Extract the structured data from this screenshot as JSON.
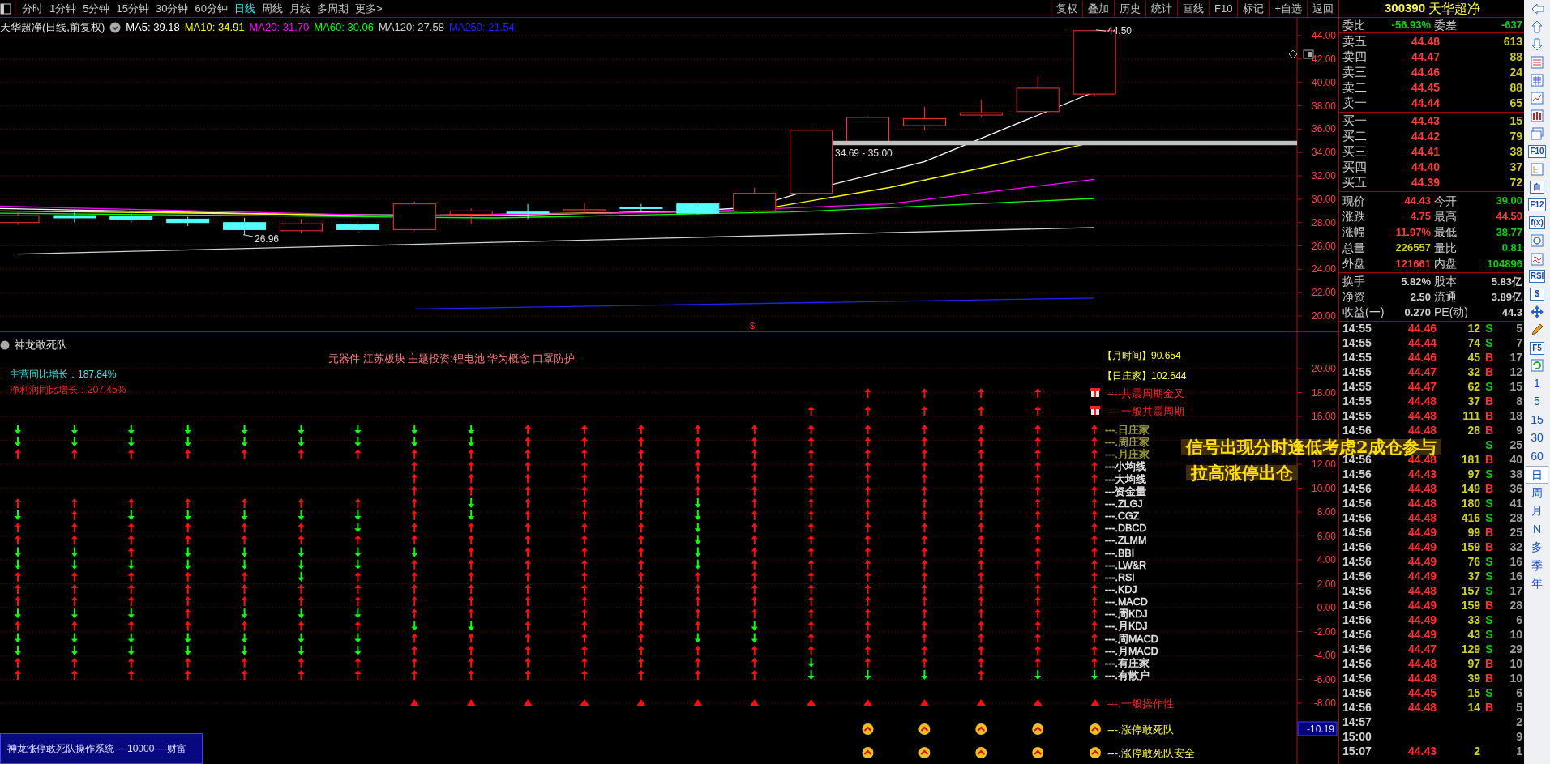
{
  "toolbar": {
    "tabs": [
      {
        "label": "分时",
        "selected": false
      },
      {
        "label": "1分钟",
        "selected": false
      },
      {
        "label": "5分钟",
        "selected": false
      },
      {
        "label": "15分钟",
        "selected": false
      },
      {
        "label": "30分钟",
        "selected": false
      },
      {
        "label": "60分钟",
        "selected": false
      },
      {
        "label": "日线",
        "selected": true
      },
      {
        "label": "周线",
        "selected": false
      },
      {
        "label": "月线",
        "selected": false
      },
      {
        "label": "多周期",
        "selected": false
      },
      {
        "label": "更多>",
        "selected": false
      }
    ],
    "buttons": [
      "复权",
      "叠加",
      "历史",
      "统计",
      "画线",
      "F10",
      "标记",
      "+自选",
      "返回"
    ]
  },
  "chart": {
    "title": "天华超净(日线,前复权)",
    "ma": [
      {
        "label": "MA5: 39.18",
        "color": "#ffffff"
      },
      {
        "label": "MA10: 34.91",
        "color": "#ffff00"
      },
      {
        "label": "MA20: 31.70",
        "color": "#ff00ff"
      },
      {
        "label": "MA60: 30.06",
        "color": "#00ff00"
      },
      {
        "label": "MA120: 27.58",
        "color": "#d0d0d0"
      },
      {
        "label": "MA250: 21.54",
        "color": "#2020ff"
      }
    ],
    "price_ticks": [
      "44.00",
      "42.00",
      "40.00",
      "38.00",
      "36.00",
      "34.00",
      "32.00",
      "30.00",
      "28.00",
      "26.00",
      "24.00",
      "22.00",
      "20.00"
    ],
    "high_label": "44.50",
    "low_label": "26.96",
    "band_label": "34.69 - 35.00",
    "marker": "$"
  },
  "indicator": {
    "title": "神龙敢死队",
    "concepts": "元器件 江苏板块 主题投资:锂电池 华为概念 口罩防护",
    "growth": [
      {
        "text": "主营同比增长：187.84%",
        "color": "#40e0e0"
      },
      {
        "text": "净利润同比增长：207.45%",
        "color": "#ff2020"
      }
    ],
    "axis_ticks": [
      "20.00",
      "18.00",
      "16.00",
      "12.00",
      "10.00",
      "8.00",
      "6.00",
      "4.00",
      "2.00",
      "0.00",
      "-2.00",
      "-4.00",
      "-6.00",
      "-8.00"
    ],
    "current_value": "-10.19",
    "system_label": "神龙涨停敢死队操作系统----10000----财富",
    "notes": [
      "【月时间】90.654",
      "【日庄家】102.644"
    ],
    "events": [
      {
        "label": "----共震周期金叉",
        "kind": "gift"
      },
      {
        "label": "----一般共震周期",
        "kind": "gift"
      }
    ],
    "signal_rows": [
      {
        "label": "---.日庄家",
        "color": "#a0a040"
      },
      {
        "label": "---.周庄家",
        "color": "#a0a040"
      },
      {
        "label": "---.月庄家",
        "color": "#a0a040"
      },
      {
        "label": "---小均线",
        "color": "#e8e8e8"
      },
      {
        "label": "---大均线",
        "color": "#e8e8e8"
      },
      {
        "label": "---资金量",
        "color": "#e8e8e8"
      },
      {
        "label": "---.ZLGJ",
        "color": "#e8e8e8"
      },
      {
        "label": "---.CGZ",
        "color": "#e8e8e8"
      },
      {
        "label": "---.DBCD",
        "color": "#e8e8e8"
      },
      {
        "label": "---.ZLMM",
        "color": "#e8e8e8"
      },
      {
        "label": "---.BBI",
        "color": "#e8e8e8"
      },
      {
        "label": "---.LW&R",
        "color": "#e8e8e8"
      },
      {
        "label": "---.RSI",
        "color": "#e8e8e8"
      },
      {
        "label": "---.KDJ",
        "color": "#e8e8e8"
      },
      {
        "label": "---.MACD",
        "color": "#e8e8e8"
      },
      {
        "label": "---.周KDJ",
        "color": "#e8e8e8"
      },
      {
        "label": "---.月KDJ",
        "color": "#e8e8e8"
      },
      {
        "label": "---.周MACD",
        "color": "#e8e8e8"
      },
      {
        "label": "---.月MACD",
        "color": "#e8e8e8"
      },
      {
        "label": "---.有庄家",
        "color": "#e8e8e8"
      },
      {
        "label": "---.有散户",
        "color": "#e8e8e8"
      }
    ],
    "markers": [
      {
        "label": "---.一般操作性",
        "kind": "triangle"
      },
      {
        "label": "---.涨停敢死队",
        "kind": "coin"
      },
      {
        "label": "---.涨停敢死队安全",
        "kind": "coin"
      }
    ],
    "columns": [
      {
        "signals": [
          {
            "kind": "down"
          },
          {
            "kind": "down"
          },
          {
            "kind": "up"
          },
          {
            "kind": "blank"
          },
          {
            "kind": "blank"
          },
          {
            "kind": "blank"
          },
          {
            "kind": "up"
          },
          {
            "kind": "down"
          },
          {
            "kind": "up"
          },
          {
            "kind": "up"
          },
          {
            "kind": "down"
          },
          {
            "kind": "down"
          },
          {
            "kind": "up"
          },
          {
            "kind": "up"
          },
          {
            "kind": "up"
          },
          {
            "kind": "down"
          },
          {
            "kind": "up"
          },
          {
            "kind": "down"
          },
          {
            "kind": "down"
          },
          {
            "kind": "up"
          },
          {
            "kind": "up"
          }
        ]
      },
      {
        "signals": [
          {
            "kind": "down"
          },
          {
            "kind": "down"
          },
          {
            "kind": "up"
          },
          {
            "kind": "blank"
          },
          {
            "kind": "blank"
          },
          {
            "kind": "blank"
          },
          {
            "kind": "up"
          },
          {
            "kind": "up"
          },
          {
            "kind": "up"
          },
          {
            "kind": "up"
          },
          {
            "kind": "down"
          },
          {
            "kind": "down"
          },
          {
            "kind": "up"
          },
          {
            "kind": "up"
          },
          {
            "kind": "up"
          },
          {
            "kind": "down"
          },
          {
            "kind": "up"
          },
          {
            "kind": "down"
          },
          {
            "kind": "down"
          },
          {
            "kind": "up"
          },
          {
            "kind": "up"
          }
        ]
      },
      {
        "signals": [
          {
            "kind": "down"
          },
          {
            "kind": "down"
          },
          {
            "kind": "up"
          },
          {
            "kind": "blank"
          },
          {
            "kind": "blank"
          },
          {
            "kind": "blank"
          },
          {
            "kind": "up"
          },
          {
            "kind": "down"
          },
          {
            "kind": "up"
          },
          {
            "kind": "up"
          },
          {
            "kind": "up"
          },
          {
            "kind": "down"
          },
          {
            "kind": "up"
          },
          {
            "kind": "up"
          },
          {
            "kind": "up"
          },
          {
            "kind": "down"
          },
          {
            "kind": "up"
          },
          {
            "kind": "down"
          },
          {
            "kind": "down"
          },
          {
            "kind": "up"
          },
          {
            "kind": "up"
          }
        ]
      },
      {
        "signals": [
          {
            "kind": "down"
          },
          {
            "kind": "down"
          },
          {
            "kind": "up"
          },
          {
            "kind": "blank"
          },
          {
            "kind": "blank"
          },
          {
            "kind": "blank"
          },
          {
            "kind": "up"
          },
          {
            "kind": "down"
          },
          {
            "kind": "up"
          },
          {
            "kind": "up"
          },
          {
            "kind": "down"
          },
          {
            "kind": "down"
          },
          {
            "kind": "up"
          },
          {
            "kind": "up"
          },
          {
            "kind": "up"
          },
          {
            "kind": "up"
          },
          {
            "kind": "up"
          },
          {
            "kind": "down"
          },
          {
            "kind": "down"
          },
          {
            "kind": "up"
          },
          {
            "kind": "up"
          }
        ]
      },
      {
        "signals": [
          {
            "kind": "down"
          },
          {
            "kind": "down"
          },
          {
            "kind": "up"
          },
          {
            "kind": "blank"
          },
          {
            "kind": "blank"
          },
          {
            "kind": "blank"
          },
          {
            "kind": "up"
          },
          {
            "kind": "down"
          },
          {
            "kind": "up"
          },
          {
            "kind": "up"
          },
          {
            "kind": "down"
          },
          {
            "kind": "down"
          },
          {
            "kind": "up"
          },
          {
            "kind": "up"
          },
          {
            "kind": "up"
          },
          {
            "kind": "down"
          },
          {
            "kind": "up"
          },
          {
            "kind": "down"
          },
          {
            "kind": "down"
          },
          {
            "kind": "up"
          },
          {
            "kind": "up"
          }
        ]
      },
      {
        "signals": [
          {
            "kind": "down"
          },
          {
            "kind": "down"
          },
          {
            "kind": "up"
          },
          {
            "kind": "blank"
          },
          {
            "kind": "blank"
          },
          {
            "kind": "blank"
          },
          {
            "kind": "up"
          },
          {
            "kind": "down"
          },
          {
            "kind": "up"
          },
          {
            "kind": "up"
          },
          {
            "kind": "down"
          },
          {
            "kind": "down"
          },
          {
            "kind": "down"
          },
          {
            "kind": "up"
          },
          {
            "kind": "up"
          },
          {
            "kind": "down"
          },
          {
            "kind": "up"
          },
          {
            "kind": "down"
          },
          {
            "kind": "down"
          },
          {
            "kind": "up"
          },
          {
            "kind": "up"
          }
        ]
      },
      {
        "signals": [
          {
            "kind": "down"
          },
          {
            "kind": "down"
          },
          {
            "kind": "up"
          },
          {
            "kind": "blank"
          },
          {
            "kind": "blank"
          },
          {
            "kind": "blank"
          },
          {
            "kind": "up"
          },
          {
            "kind": "down"
          },
          {
            "kind": "down"
          },
          {
            "kind": "up"
          },
          {
            "kind": "down"
          },
          {
            "kind": "down"
          },
          {
            "kind": "up"
          },
          {
            "kind": "up"
          },
          {
            "kind": "up"
          },
          {
            "kind": "down"
          },
          {
            "kind": "up"
          },
          {
            "kind": "down"
          },
          {
            "kind": "down"
          },
          {
            "kind": "up"
          },
          {
            "kind": "up"
          }
        ]
      },
      {
        "signals": [
          {
            "kind": "down"
          },
          {
            "kind": "down"
          },
          {
            "kind": "up"
          },
          {
            "kind": "up"
          },
          {
            "kind": "up"
          },
          {
            "kind": "up"
          },
          {
            "kind": "up"
          },
          {
            "kind": "up"
          },
          {
            "kind": "up"
          },
          {
            "kind": "up"
          },
          {
            "kind": "down"
          },
          {
            "kind": "up"
          },
          {
            "kind": "up"
          },
          {
            "kind": "up"
          },
          {
            "kind": "up"
          },
          {
            "kind": "up"
          },
          {
            "kind": "down"
          },
          {
            "kind": "up"
          },
          {
            "kind": "up"
          },
          {
            "kind": "up"
          },
          {
            "kind": "up"
          }
        ],
        "operable": true
      },
      {
        "signals": [
          {
            "kind": "down"
          },
          {
            "kind": "down"
          },
          {
            "kind": "up"
          },
          {
            "kind": "up"
          },
          {
            "kind": "up"
          },
          {
            "kind": "up"
          },
          {
            "kind": "down"
          },
          {
            "kind": "down"
          },
          {
            "kind": "up"
          },
          {
            "kind": "up"
          },
          {
            "kind": "up"
          },
          {
            "kind": "up"
          },
          {
            "kind": "up"
          },
          {
            "kind": "up"
          },
          {
            "kind": "up"
          },
          {
            "kind": "up"
          },
          {
            "kind": "down"
          },
          {
            "kind": "up"
          },
          {
            "kind": "up"
          },
          {
            "kind": "up"
          },
          {
            "kind": "up"
          }
        ],
        "operable": true
      },
      {
        "signals": [
          {
            "kind": "up"
          },
          {
            "kind": "up"
          },
          {
            "kind": "up"
          },
          {
            "kind": "up"
          },
          {
            "kind": "up"
          },
          {
            "kind": "up"
          },
          {
            "kind": "up"
          },
          {
            "kind": "up"
          },
          {
            "kind": "up"
          },
          {
            "kind": "up"
          },
          {
            "kind": "up"
          },
          {
            "kind": "up"
          },
          {
            "kind": "up"
          },
          {
            "kind": "up"
          },
          {
            "kind": "up"
          },
          {
            "kind": "up"
          },
          {
            "kind": "up"
          },
          {
            "kind": "up"
          },
          {
            "kind": "up"
          },
          {
            "kind": "up"
          },
          {
            "kind": "up"
          }
        ],
        "operable": true
      },
      {
        "signals": [
          {
            "kind": "up"
          },
          {
            "kind": "up"
          },
          {
            "kind": "up"
          },
          {
            "kind": "up"
          },
          {
            "kind": "up"
          },
          {
            "kind": "up"
          },
          {
            "kind": "up"
          },
          {
            "kind": "up"
          },
          {
            "kind": "up"
          },
          {
            "kind": "up"
          },
          {
            "kind": "up"
          },
          {
            "kind": "up"
          },
          {
            "kind": "up"
          },
          {
            "kind": "up"
          },
          {
            "kind": "up"
          },
          {
            "kind": "up"
          },
          {
            "kind": "up"
          },
          {
            "kind": "up"
          },
          {
            "kind": "up"
          },
          {
            "kind": "up"
          },
          {
            "kind": "up"
          }
        ],
        "operable": true
      },
      {
        "signals": [
          {
            "kind": "up"
          },
          {
            "kind": "up"
          },
          {
            "kind": "up"
          },
          {
            "kind": "up"
          },
          {
            "kind": "up"
          },
          {
            "kind": "up"
          },
          {
            "kind": "up"
          },
          {
            "kind": "up"
          },
          {
            "kind": "up"
          },
          {
            "kind": "up"
          },
          {
            "kind": "up"
          },
          {
            "kind": "up"
          },
          {
            "kind": "up"
          },
          {
            "kind": "up"
          },
          {
            "kind": "up"
          },
          {
            "kind": "up"
          },
          {
            "kind": "up"
          },
          {
            "kind": "up"
          },
          {
            "kind": "up"
          },
          {
            "kind": "up"
          },
          {
            "kind": "up"
          }
        ],
        "operable": true
      },
      {
        "signals": [
          {
            "kind": "up"
          },
          {
            "kind": "up"
          },
          {
            "kind": "up"
          },
          {
            "kind": "up"
          },
          {
            "kind": "up"
          },
          {
            "kind": "up"
          },
          {
            "kind": "down"
          },
          {
            "kind": "down"
          },
          {
            "kind": "down"
          },
          {
            "kind": "down"
          },
          {
            "kind": "down"
          },
          {
            "kind": "down"
          },
          {
            "kind": "up"
          },
          {
            "kind": "up"
          },
          {
            "kind": "up"
          },
          {
            "kind": "up"
          },
          {
            "kind": "up"
          },
          {
            "kind": "down"
          },
          {
            "kind": "up"
          },
          {
            "kind": "up"
          },
          {
            "kind": "up"
          }
        ],
        "operable": true
      },
      {
        "signals": [
          {
            "kind": "up"
          },
          {
            "kind": "up"
          },
          {
            "kind": "up"
          },
          {
            "kind": "up"
          },
          {
            "kind": "up"
          },
          {
            "kind": "up"
          },
          {
            "kind": "up"
          },
          {
            "kind": "up"
          },
          {
            "kind": "up"
          },
          {
            "kind": "up"
          },
          {
            "kind": "up"
          },
          {
            "kind": "up"
          },
          {
            "kind": "up"
          },
          {
            "kind": "up"
          },
          {
            "kind": "up"
          },
          {
            "kind": "up"
          },
          {
            "kind": "down"
          },
          {
            "kind": "down"
          },
          {
            "kind": "up"
          },
          {
            "kind": "up"
          },
          {
            "kind": "up"
          }
        ],
        "operable": true
      },
      {
        "signals": [
          {
            "kind": "up"
          },
          {
            "kind": "up"
          },
          {
            "kind": "up"
          },
          {
            "kind": "up"
          },
          {
            "kind": "up"
          },
          {
            "kind": "up"
          },
          {
            "kind": "up"
          },
          {
            "kind": "up"
          },
          {
            "kind": "up"
          },
          {
            "kind": "up"
          },
          {
            "kind": "up"
          },
          {
            "kind": "up"
          },
          {
            "kind": "up"
          },
          {
            "kind": "up"
          },
          {
            "kind": "up"
          },
          {
            "kind": "up"
          },
          {
            "kind": "up"
          },
          {
            "kind": "up"
          },
          {
            "kind": "up"
          },
          {
            "kind": "down"
          },
          {
            "kind": "down"
          }
        ],
        "resonance": true,
        "operable": true
      },
      {
        "signals": [
          {
            "kind": "up"
          },
          {
            "kind": "up"
          },
          {
            "kind": "up"
          },
          {
            "kind": "up"
          },
          {
            "kind": "up"
          },
          {
            "kind": "up"
          },
          {
            "kind": "up"
          },
          {
            "kind": "up"
          },
          {
            "kind": "up"
          },
          {
            "kind": "up"
          },
          {
            "kind": "up"
          },
          {
            "kind": "up"
          },
          {
            "kind": "up"
          },
          {
            "kind": "up"
          },
          {
            "kind": "up"
          },
          {
            "kind": "up"
          },
          {
            "kind": "up"
          },
          {
            "kind": "up"
          },
          {
            "kind": "up"
          },
          {
            "kind": "up"
          },
          {
            "kind": "down"
          }
        ],
        "resonance_cross": true,
        "resonance": true,
        "operable": true,
        "limit_up": true,
        "limit_up_safe": true
      },
      {
        "signals": [
          {
            "kind": "up"
          },
          {
            "kind": "up"
          },
          {
            "kind": "up"
          },
          {
            "kind": "up"
          },
          {
            "kind": "up"
          },
          {
            "kind": "up"
          },
          {
            "kind": "up"
          },
          {
            "kind": "up"
          },
          {
            "kind": "up"
          },
          {
            "kind": "up"
          },
          {
            "kind": "up"
          },
          {
            "kind": "up"
          },
          {
            "kind": "up"
          },
          {
            "kind": "up"
          },
          {
            "kind": "up"
          },
          {
            "kind": "up"
          },
          {
            "kind": "up"
          },
          {
            "kind": "up"
          },
          {
            "kind": "up"
          },
          {
            "kind": "up"
          },
          {
            "kind": "down"
          }
        ],
        "resonance_cross": true,
        "resonance": true,
        "operable": true,
        "limit_up": true,
        "limit_up_safe": true
      },
      {
        "signals": [
          {
            "kind": "up"
          },
          {
            "kind": "up"
          },
          {
            "kind": "up"
          },
          {
            "kind": "up"
          },
          {
            "kind": "up"
          },
          {
            "kind": "up"
          },
          {
            "kind": "up"
          },
          {
            "kind": "up"
          },
          {
            "kind": "up"
          },
          {
            "kind": "up"
          },
          {
            "kind": "up"
          },
          {
            "kind": "up"
          },
          {
            "kind": "up"
          },
          {
            "kind": "up"
          },
          {
            "kind": "up"
          },
          {
            "kind": "up"
          },
          {
            "kind": "up"
          },
          {
            "kind": "up"
          },
          {
            "kind": "up"
          },
          {
            "kind": "up"
          },
          {
            "kind": "up"
          }
        ],
        "resonance_cross": true,
        "resonance": true,
        "operable": true,
        "limit_up": true,
        "limit_up_safe": true
      },
      {
        "signals": [
          {
            "kind": "up"
          },
          {
            "kind": "up"
          },
          {
            "kind": "up"
          },
          {
            "kind": "up"
          },
          {
            "kind": "up"
          },
          {
            "kind": "up"
          },
          {
            "kind": "up"
          },
          {
            "kind": "up"
          },
          {
            "kind": "up"
          },
          {
            "kind": "up"
          },
          {
            "kind": "up"
          },
          {
            "kind": "up"
          },
          {
            "kind": "up"
          },
          {
            "kind": "up"
          },
          {
            "kind": "up"
          },
          {
            "kind": "up"
          },
          {
            "kind": "up"
          },
          {
            "kind": "up"
          },
          {
            "kind": "up"
          },
          {
            "kind": "up"
          },
          {
            "kind": "down"
          }
        ],
        "resonance_cross": true,
        "resonance": true,
        "operable": true,
        "limit_up": true,
        "limit_up_safe": true
      },
      {
        "signals": [
          {
            "kind": "up"
          },
          {
            "kind": "up"
          },
          {
            "kind": "up"
          },
          {
            "kind": "up"
          },
          {
            "kind": "up"
          },
          {
            "kind": "up"
          },
          {
            "kind": "up"
          },
          {
            "kind": "up"
          },
          {
            "kind": "up"
          },
          {
            "kind": "up"
          },
          {
            "kind": "up"
          },
          {
            "kind": "up"
          },
          {
            "kind": "up"
          },
          {
            "kind": "up"
          },
          {
            "kind": "up"
          },
          {
            "kind": "up"
          },
          {
            "kind": "up"
          },
          {
            "kind": "up"
          },
          {
            "kind": "up"
          },
          {
            "kind": "up"
          },
          {
            "kind": "down"
          }
        ]
      }
    ]
  },
  "annotation": {
    "lines": [
      "信号出现分时逢低考虑2成仓参与",
      "拉高涨停出仓"
    ]
  },
  "quote": {
    "code": "300390",
    "name": "天华超净",
    "ratio": [
      {
        "label": "委比",
        "value": "-56.93%",
        "color": "#10d010"
      },
      {
        "label": "委差",
        "value": "-637",
        "color": "#10d010"
      }
    ],
    "sell": [
      {
        "label": "卖五",
        "price": "44.48",
        "volume": "613"
      },
      {
        "label": "卖四",
        "price": "44.47",
        "volume": "88"
      },
      {
        "label": "卖三",
        "price": "44.46",
        "volume": "24"
      },
      {
        "label": "卖二",
        "price": "44.45",
        "volume": "88"
      },
      {
        "label": "卖一",
        "price": "44.44",
        "volume": "65"
      }
    ],
    "buy": [
      {
        "label": "买一",
        "price": "44.43",
        "volume": "15"
      },
      {
        "label": "买二",
        "price": "44.42",
        "volume": "79"
      },
      {
        "label": "买三",
        "price": "44.41",
        "volume": "38"
      },
      {
        "label": "买四",
        "price": "44.40",
        "volume": "37"
      },
      {
        "label": "买五",
        "price": "44.39",
        "volume": "72"
      }
    ],
    "stats": [
      {
        "label": "现价",
        "value": "44.43",
        "color": "#ff3c3c"
      },
      {
        "label": "今开",
        "value": "39.00",
        "color": "#10d010"
      },
      {
        "label": "涨跌",
        "value": "4.75",
        "color": "#ff3c3c"
      },
      {
        "label": "最高",
        "value": "44.50",
        "color": "#ff3c3c"
      },
      {
        "label": "涨幅",
        "value": "11.97%",
        "color": "#ff3c3c"
      },
      {
        "label": "最低",
        "value": "38.77",
        "color": "#10d010"
      },
      {
        "label": "总量",
        "value": "226557",
        "color": "#d0d020"
      },
      {
        "label": "量比",
        "value": "0.81",
        "color": "#10d010"
      },
      {
        "label": "外盘",
        "value": "121661",
        "color": "#ff3c3c"
      },
      {
        "label": "内盘",
        "value": "104896",
        "color": "#10d010"
      }
    ],
    "finance": [
      {
        "label": "换手",
        "value": "5.82%"
      },
      {
        "label": "股本",
        "value": "5.83亿"
      },
      {
        "label": "净资",
        "value": "2.50"
      },
      {
        "label": "流通",
        "value": "3.89亿"
      },
      {
        "label": "收益(一)",
        "value": "0.270"
      },
      {
        "label": "PE(动)",
        "value": "44.3"
      }
    ],
    "ticks": [
      {
        "time": "14:55",
        "price": "44.46",
        "volume": "12",
        "side": "S",
        "kind": "sell",
        "count": "5"
      },
      {
        "time": "14:55",
        "price": "44.44",
        "volume": "74",
        "side": "S",
        "kind": "sell",
        "count": "7"
      },
      {
        "time": "14:55",
        "price": "44.46",
        "volume": "45",
        "side": "B",
        "kind": "buy",
        "count": "17"
      },
      {
        "time": "14:55",
        "price": "44.47",
        "volume": "32",
        "side": "B",
        "kind": "buy",
        "count": "12"
      },
      {
        "time": "14:55",
        "price": "44.47",
        "volume": "62",
        "side": "S",
        "kind": "sell",
        "count": "15"
      },
      {
        "time": "14:55",
        "price": "44.48",
        "volume": "37",
        "side": "B",
        "kind": "buy",
        "count": "8"
      },
      {
        "time": "14:55",
        "price": "44.48",
        "volume": "111",
        "side": "B",
        "kind": "buy",
        "count": "18"
      },
      {
        "time": "14:56",
        "price": "44.48",
        "volume": "28",
        "side": "B",
        "kind": "buy",
        "count": "9"
      },
      {
        "side": "S",
        "kind": "sell",
        "count": "25"
      },
      {
        "time": "14:56",
        "price": "44.48",
        "volume": "181",
        "side": "B",
        "kind": "buy",
        "count": "40"
      },
      {
        "time": "14:56",
        "price": "44.43",
        "volume": "97",
        "side": "S",
        "kind": "sell",
        "count": "38"
      },
      {
        "time": "14:56",
        "price": "44.48",
        "volume": "149",
        "side": "B",
        "kind": "buy",
        "count": "36"
      },
      {
        "time": "14:56",
        "price": "44.48",
        "volume": "180",
        "side": "S",
        "kind": "sell",
        "count": "41"
      },
      {
        "time": "14:56",
        "price": "44.48",
        "volume": "416",
        "side": "S",
        "kind": "sell",
        "count": "28"
      },
      {
        "time": "14:56",
        "price": "44.49",
        "volume": "99",
        "side": "B",
        "kind": "buy",
        "count": "25"
      },
      {
        "time": "14:56",
        "price": "44.49",
        "volume": "159",
        "side": "B",
        "kind": "buy",
        "count": "32"
      },
      {
        "time": "14:56",
        "price": "44.49",
        "volume": "76",
        "side": "S",
        "kind": "sell",
        "count": "16"
      },
      {
        "time": "14:56",
        "price": "44.49",
        "volume": "37",
        "side": "S",
        "kind": "sell",
        "count": "16"
      },
      {
        "time": "14:56",
        "price": "44.48",
        "volume": "157",
        "side": "S",
        "kind": "sell",
        "count": "17"
      },
      {
        "time": "14:56",
        "price": "44.49",
        "volume": "159",
        "side": "B",
        "kind": "buy",
        "count": "28"
      },
      {
        "time": "14:56",
        "price": "44.49",
        "volume": "33",
        "side": "S",
        "kind": "sell",
        "count": "6"
      },
      {
        "time": "14:56",
        "price": "44.49",
        "volume": "43",
        "side": "S",
        "kind": "sell",
        "count": "10"
      },
      {
        "time": "14:56",
        "price": "44.47",
        "volume": "129",
        "side": "S",
        "kind": "sell",
        "count": "29"
      },
      {
        "time": "14:56",
        "price": "44.48",
        "volume": "97",
        "side": "B",
        "kind": "buy",
        "count": "10"
      },
      {
        "time": "14:56",
        "price": "44.48",
        "volume": "39",
        "side": "B",
        "kind": "buy",
        "count": "10"
      },
      {
        "time": "14:56",
        "price": "44.45",
        "volume": "15",
        "side": "S",
        "kind": "sell",
        "count": "6"
      },
      {
        "time": "14:56",
        "price": "44.48",
        "volume": "14",
        "side": "B",
        "kind": "buy",
        "count": "5"
      },
      {
        "time": "14:57",
        "count": "2"
      },
      {
        "time": "15:00",
        "count": "9"
      },
      {
        "time": "15:07",
        "price": "44.43",
        "volume": "2",
        "count": "1"
      }
    ]
  },
  "side_strip": {
    "tools": [
      {
        "kind": "arrow-left"
      },
      {
        "kind": "arrow-up"
      },
      {
        "kind": "arrow-down"
      },
      {
        "kind": "list"
      },
      {
        "kind": "grid"
      },
      {
        "kind": "line"
      },
      {
        "kind": "candles"
      },
      {
        "kind": "windows"
      },
      {
        "kind": "text",
        "label": "F10"
      },
      {
        "kind": "tree"
      },
      {
        "kind": "text",
        "label": "自"
      },
      {
        "kind": "text",
        "label": "F12"
      },
      {
        "kind": "text",
        "label": "f(x)"
      },
      {
        "kind": "circle"
      },
      {
        "kind": "wave"
      },
      {
        "kind": "text",
        "label": "RSI"
      },
      {
        "kind": "text",
        "label": "$"
      },
      {
        "kind": "move"
      },
      {
        "kind": "pencil"
      },
      {
        "kind": "text",
        "label": "F5"
      },
      {
        "kind": "refresh"
      }
    ],
    "periods": [
      {
        "label": "1",
        "selected": false
      },
      {
        "label": "5",
        "selected": false
      },
      {
        "label": "15",
        "selected": false
      },
      {
        "label": "30",
        "selected": false
      },
      {
        "label": "60",
        "selected": false
      },
      {
        "label": "日",
        "selected": true
      },
      {
        "label": "周",
        "selected": false
      },
      {
        "label": "月",
        "selected": false
      },
      {
        "label": "N",
        "selected": false
      },
      {
        "label": "多",
        "selected": false
      },
      {
        "label": "季",
        "selected": false
      },
      {
        "label": "年",
        "selected": false
      }
    ]
  }
}
